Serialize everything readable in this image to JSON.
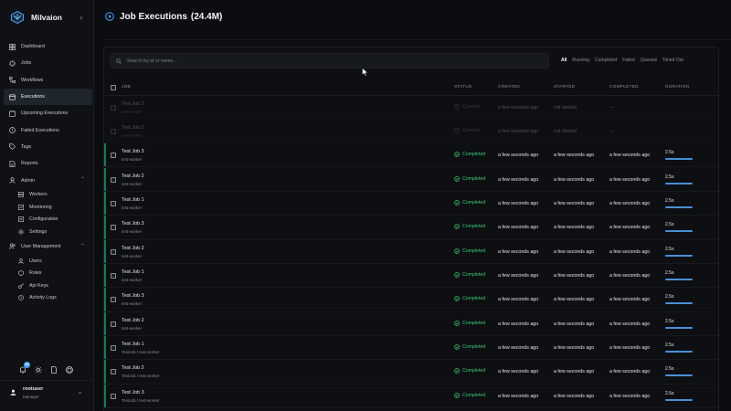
{
  "app": {
    "name": "Milvaion"
  },
  "sidebar": {
    "items": [
      {
        "label": "Dashboard",
        "icon": "dashboard-icon"
      },
      {
        "label": "Jobs",
        "icon": "jobs-icon"
      },
      {
        "label": "Workflows",
        "icon": "workflows-icon"
      },
      {
        "label": "Executions",
        "icon": "executions-icon",
        "active": true
      },
      {
        "label": "Upcoming Executions",
        "icon": "clock-icon"
      },
      {
        "label": "Failed Executions",
        "icon": "alert-icon"
      },
      {
        "label": "Tags",
        "icon": "tag-icon"
      },
      {
        "label": "Reports",
        "icon": "reports-icon"
      }
    ],
    "admin": {
      "label": "Admin",
      "items": [
        {
          "label": "Workers",
          "icon": "workers-icon"
        },
        {
          "label": "Monitoring",
          "icon": "monitoring-icon"
        },
        {
          "label": "Configuration",
          "icon": "configuration-icon"
        },
        {
          "label": "Settings",
          "icon": "settings-icon"
        }
      ]
    },
    "user_management": {
      "label": "User Management",
      "items": [
        {
          "label": "Users",
          "icon": "users-icon"
        },
        {
          "label": "Roles",
          "icon": "roles-icon"
        },
        {
          "label": "Api Keys",
          "icon": "key-icon"
        },
        {
          "label": "Activity Logs",
          "icon": "activity-icon"
        }
      ]
    },
    "notification_count": "10",
    "user": {
      "name": "rootuser",
      "role": "Manager"
    }
  },
  "page": {
    "title": "Job Executions",
    "count": "(24.4M)"
  },
  "search": {
    "placeholder": "Search by id or name..."
  },
  "filters": [
    "All",
    "Running",
    "Completed",
    "Failed",
    "Queued",
    "Timed Out"
  ],
  "active_filter": "All",
  "table": {
    "headers": {
      "job": "JOB",
      "status": "STATUS",
      "created": "CREATED",
      "started": "STARTED",
      "completed": "COMPLETED",
      "duration": "DURATION"
    },
    "rows": [
      {
        "name": "Test Job 3",
        "sub": "test-worker",
        "status": "Queued",
        "created": "a few seconds ago",
        "started": "not started",
        "completed": "—",
        "duration": "",
        "faded": true
      },
      {
        "name": "Test Job 2",
        "sub": "test-worker",
        "status": "Queued",
        "created": "a few seconds ago",
        "started": "not started",
        "completed": "—",
        "duration": "",
        "faded": true
      },
      {
        "name": "Test Job 3",
        "sub": "test-worker",
        "status": "Completed",
        "created": "a few seconds ago",
        "started": "a few seconds ago",
        "completed": "a few seconds ago",
        "duration": "2.5s"
      },
      {
        "name": "Test Job 2",
        "sub": "test-worker",
        "status": "Completed",
        "created": "a few seconds ago",
        "started": "a few seconds ago",
        "completed": "a few seconds ago",
        "duration": "2.5s"
      },
      {
        "name": "Test Job 1",
        "sub": "test-worker",
        "status": "Completed",
        "created": "a few seconds ago",
        "started": "a few seconds ago",
        "completed": "a few seconds ago",
        "duration": "2.5s"
      },
      {
        "name": "Test Job 3",
        "sub": "test-worker",
        "status": "Completed",
        "created": "a few seconds ago",
        "started": "a few seconds ago",
        "completed": "a few seconds ago",
        "duration": "2.5s"
      },
      {
        "name": "Test Job 2",
        "sub": "test-worker",
        "status": "Completed",
        "created": "a few seconds ago",
        "started": "a few seconds ago",
        "completed": "a few seconds ago",
        "duration": "2.5s"
      },
      {
        "name": "Test Job 1",
        "sub": "test-worker",
        "status": "Completed",
        "created": "a few seconds ago",
        "started": "a few seconds ago",
        "completed": "a few seconds ago",
        "duration": "2.5s"
      },
      {
        "name": "Test Job 3",
        "sub": "test-worker",
        "status": "Completed",
        "created": "a few seconds ago",
        "started": "a few seconds ago",
        "completed": "a few seconds ago",
        "duration": "2.5s"
      },
      {
        "name": "Test Job 2",
        "sub": "test-worker",
        "status": "Completed",
        "created": "a few seconds ago",
        "started": "a few seconds ago",
        "completed": "a few seconds ago",
        "duration": "2.5s"
      },
      {
        "name": "Test Job 1",
        "sub": "TestJob / test-worker",
        "status": "Completed",
        "created": "a few seconds ago",
        "started": "a few seconds ago",
        "completed": "a few seconds ago",
        "duration": "2.5s"
      },
      {
        "name": "Test Job 2",
        "sub": "TestJob / test-worker",
        "status": "Completed",
        "created": "a few seconds ago",
        "started": "a few seconds ago",
        "completed": "a few seconds ago",
        "duration": "2.5s"
      },
      {
        "name": "Test Job 3",
        "sub": "TestJob / test-worker",
        "status": "Completed",
        "created": "a few seconds ago",
        "started": "a few seconds ago",
        "completed": "a few seconds ago",
        "duration": "2.5s"
      }
    ]
  },
  "colors": {
    "accent": "#4aa3ff",
    "success": "#3ec979",
    "active_bar": "#1f7a4f"
  }
}
